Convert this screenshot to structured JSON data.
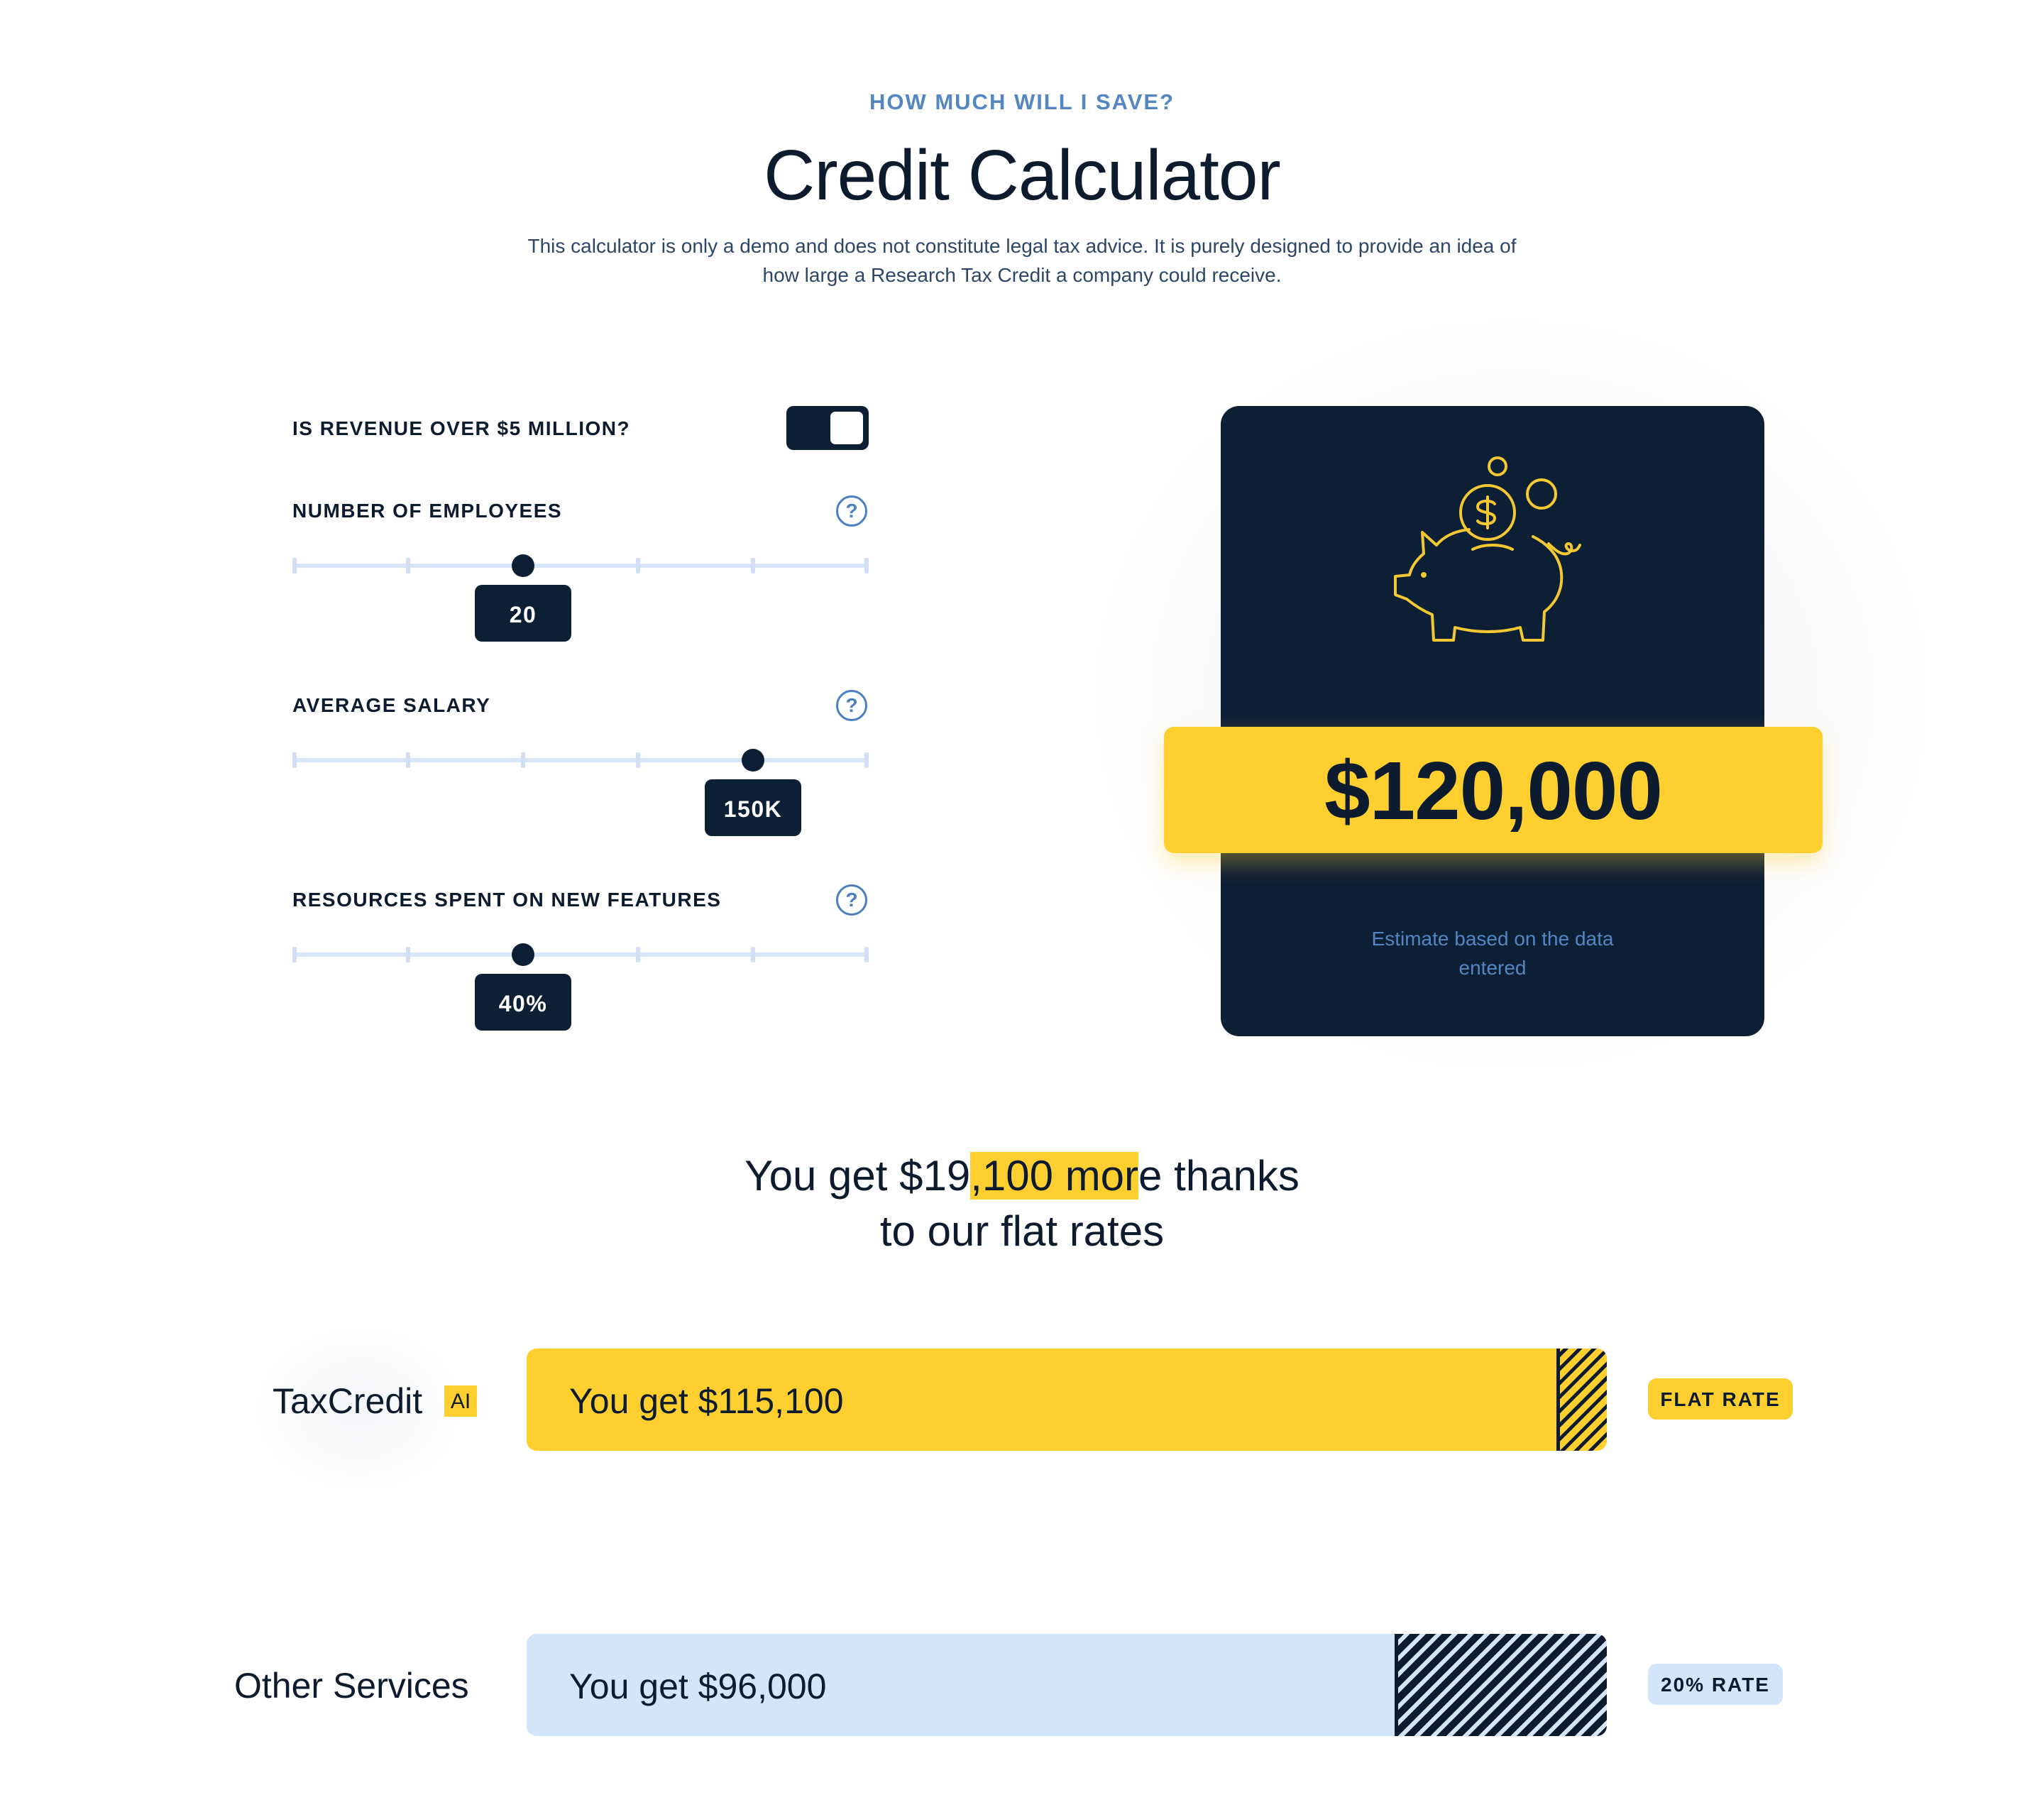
{
  "header": {
    "eyebrow": "HOW MUCH WILL I SAVE?",
    "title": "Credit Calculator",
    "subtitle_line1": "This calculator is only a demo and does not constitute legal tax advice. It is purely designed to provide an idea of",
    "subtitle_line2": "how large a Research Tax Credit a company could receive."
  },
  "controls": {
    "revenue": {
      "label": "IS REVENUE OVER $5 MILLION?",
      "toggle_on": true
    },
    "employees": {
      "label": "NUMBER OF EMPLOYEES",
      "value_label": "20",
      "help": "?"
    },
    "salary": {
      "label": "AVERAGE SALARY",
      "value_label": "150K",
      "help": "?"
    },
    "resources": {
      "label": "RESOURCES SPENT ON NEW FEATURES",
      "value_label": "40%",
      "help": "?"
    }
  },
  "result": {
    "icon": "piggy-bank-icon",
    "amount": "$120,000",
    "note_line1": "Estimate based on the data",
    "note_line2": "entered"
  },
  "comparison": {
    "headline_pre": "You get $19",
    "headline_highlight": ",100 mor",
    "headline_post": "e thanks",
    "headline_line2": "to our flat rates",
    "taxcredit": {
      "logo_text": "TaxCredit",
      "logo_badge": "AI",
      "bar_text": "You get $115,100",
      "tag": "FLAT RATE"
    },
    "other": {
      "label": "Other Services",
      "bar_text": "You get $96,000",
      "tag": "20% RATE"
    }
  },
  "colors": {
    "navy": "#0d1f35",
    "yellow": "#ffcf2f",
    "light_blue": "#d3e5f8",
    "accent_blue": "#5487c2"
  }
}
